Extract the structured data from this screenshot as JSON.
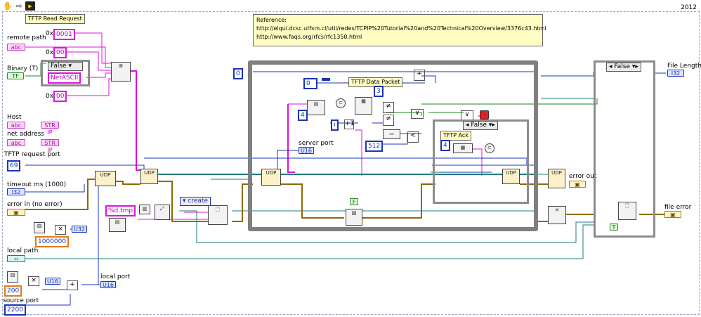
{
  "toolbar": {
    "hand_icon": "hand-icon",
    "arrow_icon": "run-arrow-icon",
    "highlight_icon": "highlight-execution-icon",
    "version_label": "2012"
  },
  "diagram": {
    "title_label": "TFTP Read Request",
    "reference": {
      "title": "Reference:",
      "lines": [
        "http://elqui.dcsc.utfsm.cl/util/redes/TCPIP%20Tutorial%20and%20Technical%20Overview/3376c43.html",
        "http://www.faqs.org/rfcs/rfc1350.html"
      ]
    },
    "inputs": {
      "remote_path": "remote path",
      "binary": "Binary (T)",
      "host": "Host",
      "net_address": "net address",
      "tftp_port": "TFTP request port",
      "timeout": "timeout ms (1000)",
      "error_in": "error in (no error)",
      "local_path": "local path",
      "source_port": "source port",
      "local_port": "local port"
    },
    "terminals": {
      "str": "abc",
      "bool": "TF",
      "i32": "I32",
      "u16": "U16",
      "str_ip": "STR IP"
    },
    "constants": {
      "opcode_1": "0001",
      "zero_a": "00",
      "zero_b": "00",
      "prefix_0x_a": "0x",
      "prefix_0x_b": "0x",
      "prefix_0x_c": "0x",
      "netascii": "NetASCII",
      "case_false": "False",
      "port_69": "69",
      "rand_max": "1000000",
      "u32": "U32",
      "tmp_fmt": "%d.tmp",
      "create": "create",
      "port_200": "200",
      "port_2200": "2200",
      "loop_index": "0",
      "const_0": "0",
      "const_4a": "4",
      "const_4b": "4",
      "const_3": "3",
      "const_512": "512",
      "const_i": "i",
      "false_f": "F",
      "true_t": "T"
    },
    "labels": {
      "server_port": "server port",
      "tftp_data_packet": "TFTP Data Packet",
      "tftp_ack": "TFTP Ack",
      "case_false_inner": "False",
      "case_false_outer": "False",
      "file_length": "File Length",
      "error_out": "error out",
      "file_error": "file error"
    }
  }
}
